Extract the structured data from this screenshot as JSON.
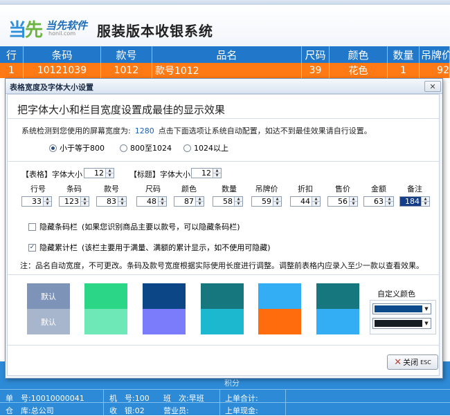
{
  "app": {
    "title": "服装版本收银系统",
    "logo_text_a": "当",
    "logo_text_b": "先",
    "logo_sub": "当先软件",
    "logo_url": "honil.com"
  },
  "grid": {
    "columns": [
      "行",
      "条码",
      "款号",
      "品名",
      "尺码",
      "颜色",
      "数量",
      "吊牌价"
    ],
    "row": [
      "1",
      "10121039",
      "1012",
      "款号1012",
      "39",
      "花色",
      "1",
      "92"
    ]
  },
  "footer": {
    "partial_label": "积分",
    "doc_no": "单　号:10010000041",
    "machine_no": "机　号:100",
    "shift": "班　次:早班",
    "last_total": "上单合计:",
    "store": "仓　库:总公司",
    "cashier": "收　银:02",
    "staff": "营业员:",
    "last_cash": "上单现金:"
  },
  "dialog": {
    "title": "表格宽度及字体大小设置",
    "close_icon": "close-icon",
    "headline": "把字体大小和栏目宽度设置成最佳的显示效果",
    "detect_prefix": "系统检测到您使用的屏幕宽度为:",
    "detect_width": "1280",
    "detect_suffix": "点击下面选项让系统自动配置，如达不到最佳效果请自行设置。",
    "radios": [
      {
        "label": "小于等于800",
        "checked": true
      },
      {
        "label": "800至1024",
        "checked": false
      },
      {
        "label": "1024以上",
        "checked": false
      }
    ],
    "table_font_label": "【表格】字体大小",
    "table_font_value": "12",
    "title_font_label": "【标题】字体大小",
    "title_font_value": "12",
    "columns": [
      {
        "label": "行号",
        "value": "33"
      },
      {
        "label": "条码",
        "value": "123"
      },
      {
        "label": "款号",
        "value": "83"
      },
      {
        "label": "尺码",
        "value": "48"
      },
      {
        "label": "颜色",
        "value": "87"
      },
      {
        "label": "数量",
        "value": "58"
      },
      {
        "label": "吊牌价",
        "value": "59"
      },
      {
        "label": "折扣",
        "value": "44"
      },
      {
        "label": "售价",
        "value": "56"
      },
      {
        "label": "金额",
        "value": "63"
      },
      {
        "label": "备注",
        "value": "184"
      }
    ],
    "hide_barcode": {
      "label": "隐藏条码栏",
      "note": "(如果您识别商品主要以款号，可以隐藏条码栏)",
      "checked": false
    },
    "hide_cumulative": {
      "label": "隐藏累计栏",
      "note": "(该栏主要用于满量、满额的累计显示，如不使用可隐藏)",
      "checked": true
    },
    "note": "注：品名自动宽度，不可更改。条码及款号宽度根据实际使用长度进行调整。调整前表格内应录入至少一款以查看效果。",
    "swatches": [
      {
        "top": "#7e93b8",
        "bottom": "#a7b6cd",
        "top_label": "默认",
        "bottom_label": "默认"
      },
      {
        "top": "#2bd687",
        "bottom": "#6ee8b6",
        "top_label": "",
        "bottom_label": ""
      },
      {
        "top": "#0c4686",
        "bottom": "#7b7cfb",
        "top_label": "",
        "bottom_label": ""
      },
      {
        "top": "#16787e",
        "bottom": "#1bb8cf",
        "top_label": "",
        "bottom_label": ""
      },
      {
        "top": "#33aef4",
        "bottom": "#fe6c0e",
        "top_label": "",
        "bottom_label": ""
      },
      {
        "top": "#16787e",
        "bottom": "#33aef4",
        "top_label": "",
        "bottom_label": ""
      }
    ],
    "custom_label": "自定义颜色",
    "custom_colors": [
      "#0d4a8c",
      "#161d23"
    ],
    "close_button": {
      "label": "关闭",
      "key": "ESC"
    }
  }
}
